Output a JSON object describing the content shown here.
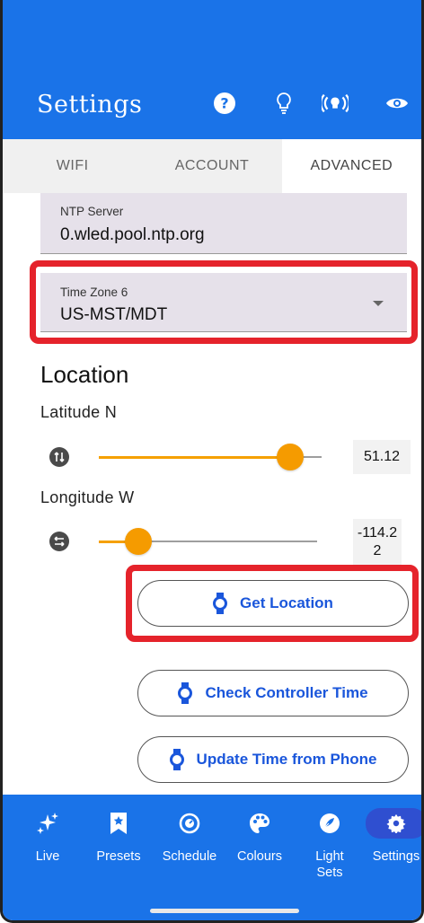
{
  "header": {
    "title": "Settings",
    "bg_color": "#1a73e8",
    "icons": [
      "help-icon",
      "lightbulb-icon",
      "broadcast-icon",
      "eye-icon"
    ]
  },
  "tabs": [
    {
      "label": "WIFI",
      "active": false
    },
    {
      "label": "ACCOUNT",
      "active": false
    },
    {
      "label": "ADVANCED",
      "active": true
    }
  ],
  "ntp": {
    "label": "NTP Server",
    "value": "0.wled.pool.ntp.org"
  },
  "timezone": {
    "label": "Time Zone 6",
    "value": "US-MST/MDT"
  },
  "location": {
    "heading": "Location",
    "latitude": {
      "label": "Latitude N",
      "value": "51.12",
      "level": 0.86
    },
    "longitude": {
      "label": "Longitude W",
      "value": "-114.2\n2",
      "level": 0.18
    }
  },
  "buttons": {
    "get_location": "Get Location",
    "check_time": "Check Controller Time",
    "update_time": "Update Time from Phone"
  },
  "nav": {
    "items": [
      {
        "label": "Live",
        "icon": "sparkles-icon"
      },
      {
        "label": "Presets",
        "icon": "bookmark-star-icon"
      },
      {
        "label": "Schedule",
        "icon": "clock-icon"
      },
      {
        "label": "Colours",
        "icon": "palette-icon"
      },
      {
        "label": "Light\nSets",
        "icon": "light-sets-icon"
      },
      {
        "label": "Settings",
        "icon": "gear-icon",
        "active": true
      }
    ]
  },
  "colors": {
    "accent": "#1a73e8",
    "slider": "#f59b00",
    "highlight": "#e5232b",
    "button_text": "#1a56db"
  }
}
